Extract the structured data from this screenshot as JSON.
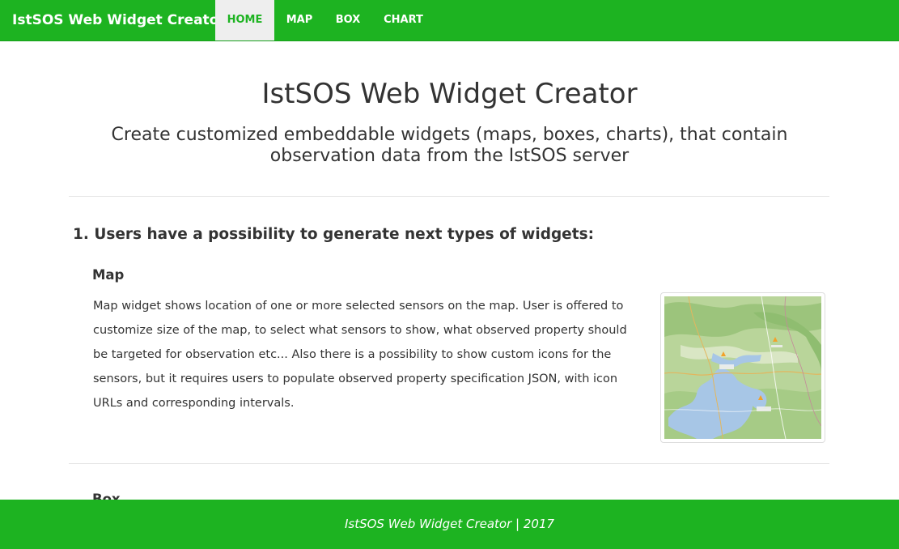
{
  "navbar": {
    "brand": "IstSOS Web Widget Creator",
    "items": [
      {
        "label": "HOME",
        "active": true
      },
      {
        "label": "MAP",
        "active": false
      },
      {
        "label": "BOX",
        "active": false
      },
      {
        "label": "CHART",
        "active": false
      }
    ]
  },
  "header": {
    "title": "IstSOS Web Widget Creator",
    "subtitle": "Create customized embeddable widgets (maps, boxes, charts), that contain observation data from the IstSOS server"
  },
  "section": {
    "heading": "1. Users have a possibility to generate next types of widgets:",
    "widgets": [
      {
        "title": "Map",
        "description": "Map widget shows location of one or more selected sensors on the map. User is offered to customize size of the map, to select what sensors to show, what observed property should be targeted for observation etc... Also there is a possibility to show custom icons for the sensors, but it requires users to populate observed property specification JSON, with icon URLs and corresponding intervals."
      },
      {
        "title": "Box"
      }
    ]
  },
  "footer": {
    "text": "IstSOS Web Widget Creator | 2017"
  },
  "colors": {
    "brand_green": "#1db321",
    "active_tab_bg": "#eeeeee"
  }
}
